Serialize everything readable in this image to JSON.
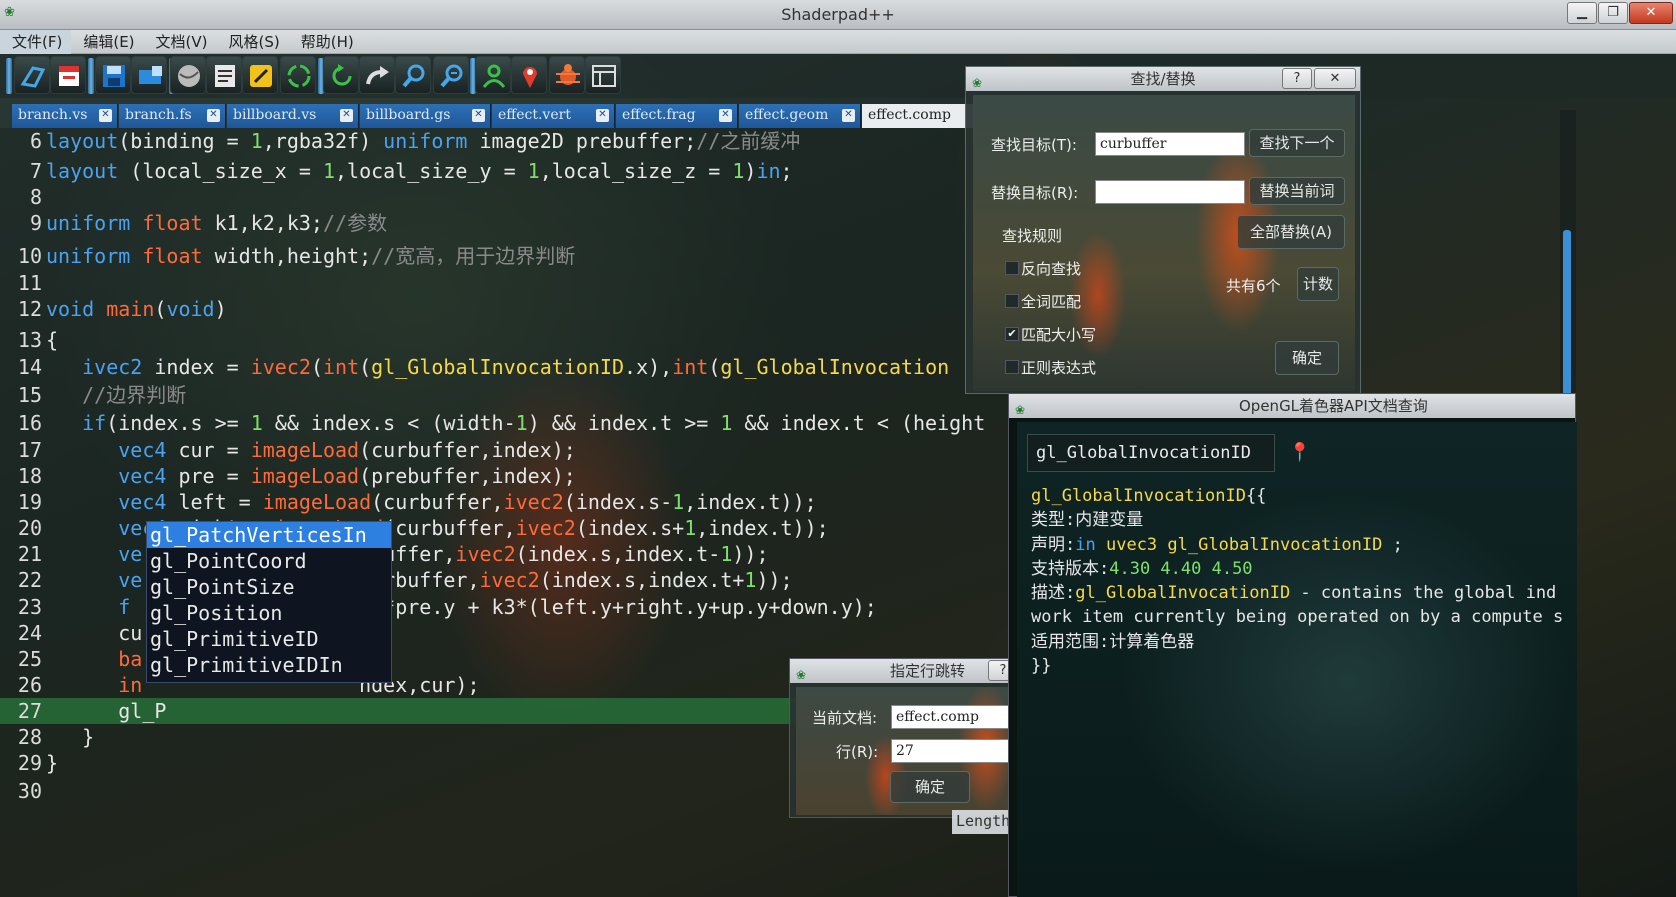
{
  "window": {
    "title": "Shaderpad++",
    "min": "▁",
    "max": "❐",
    "close": "✕"
  },
  "menu": [
    "文件(F)",
    "编辑(E)",
    "文档(V)",
    "风格(S)",
    "帮助(H)"
  ],
  "toolbar_icons": [
    "open-icon",
    "close-doc-icon",
    "save-icon",
    "save-as-icon",
    "sphere-icon",
    "document-icon",
    "edit-icon",
    "refresh-icon",
    "undo-icon",
    "redo-icon",
    "find-icon",
    "replace-icon",
    "user-icon",
    "location-icon",
    "bug-icon",
    "panel-icon"
  ],
  "tabs": [
    {
      "label": "branch.vs"
    },
    {
      "label": "branch.fs"
    },
    {
      "label": "billboard.vs"
    },
    {
      "label": "billboard.gs"
    },
    {
      "label": "effect.vert"
    },
    {
      "label": "effect.frag"
    },
    {
      "label": "effect.geom"
    },
    {
      "label": "effect.comp"
    }
  ],
  "editor": {
    "current_line": 27,
    "lines": [
      {
        "n": "6",
        "html": "<span class='kw'>layout</span>(binding = <span class='num'>1</span>,rgba32f) <span class='kw'>uniform</span> image2D prebuffer;<span class='cm'>//之前缓冲</span>"
      },
      {
        "n": "7",
        "html": "<span class='kw'>layout</span> (local_size_x = <span class='num'>1</span>,local_size_y = <span class='num'>1</span>,local_size_z = <span class='num'>1</span>)<span class='kw'>in</span>;"
      },
      {
        "n": "8",
        "html": ""
      },
      {
        "n": "9",
        "html": "<span class='kw'>uniform</span> <span class='fn'>float</span> k1,k2,k3;<span class='cm'>//参数</span>"
      },
      {
        "n": "10",
        "html": "<span class='kw'>uniform</span> <span class='fn'>float</span> width,height;<span class='cm'>//宽高，用于边界判断</span>"
      },
      {
        "n": "11",
        "html": ""
      },
      {
        "n": "12",
        "html": "<span class='kw'>void</span> <span class='fn'>main</span>(<span class='kw'>void</span>)"
      },
      {
        "n": "13",
        "html": "{"
      },
      {
        "n": "14",
        "html": "   <span class='kw'>ivec2</span> index = <span class='fn'>ivec2</span>(<span class='fn'>int</span>(<span class='gv'>gl_GlobalInvocationID</span>.x),<span class='fn'>int</span>(<span class='gv'>gl_GlobalInvocation</span>"
      },
      {
        "n": "15",
        "html": "   <span class='cm'>//边界判断</span>"
      },
      {
        "n": "16",
        "html": "   <span class='kw'>if</span>(index.s &gt;= <span class='num'>1</span> &amp;&amp; index.s &lt; (width-<span class='num'>1</span>) &amp;&amp; index.t &gt;= <span class='num'>1</span> &amp;&amp; index.t &lt; (height"
      },
      {
        "n": "17",
        "html": "      <span class='kw'>vec4</span> cur = <span class='fn'>imageLoad</span>(curbuffer,index);"
      },
      {
        "n": "18",
        "html": "      <span class='kw'>vec4</span> pre = <span class='fn'>imageLoad</span>(prebuffer,index);"
      },
      {
        "n": "19",
        "html": "      <span class='kw'>vec4</span> left = <span class='fn'>imageLoad</span>(curbuffer,<span class='fn'>ivec2</span>(index.s-<span class='num'>1</span>,index.t));"
      },
      {
        "n": "20",
        "html": "      <span class='kw'>vec4</span> right = <span class='fn'>imageLoad</span>(curbuffer,<span class='fn'>ivec2</span>(index.s+<span class='num'>1</span>,index.t));"
      },
      {
        "n": "21",
        "html": "      <span class='kw'>ve</span>                  rbuffer,<span class='fn'>ivec2</span>(index.s,index.t-<span class='num'>1</span>));"
      },
      {
        "n": "22",
        "html": "      <span class='kw'>ve</span>                  curbuffer,<span class='fn'>ivec2</span>(index.s,index.t+<span class='num'>1</span>));"
      },
      {
        "n": "23",
        "html": "      <span class='kw'>f</span>                   k2*pre.y + k3*(left.y+right.y+up.y+down.y);"
      },
      {
        "n": "24",
        "html": "      cu"
      },
      {
        "n": "25",
        "html": "      <span class='fn'>ba</span>"
      },
      {
        "n": "26",
        "html": "      <span class='fn'>in</span>                  ndex,cur);"
      },
      {
        "n": "27",
        "html": "      gl_P"
      },
      {
        "n": "28",
        "html": "   }"
      },
      {
        "n": "29",
        "html": "}"
      },
      {
        "n": "30",
        "html": ""
      }
    ]
  },
  "autocomplete": [
    "gl_PatchVerticesIn",
    "gl_PointCoord",
    "gl_PointSize",
    "gl_Position",
    "gl_PrimitiveID",
    "gl_PrimitiveIDIn"
  ],
  "find_dialog": {
    "title": "查找/替换",
    "help_label": "?",
    "close_label": "✕",
    "find_label": "查找目标(T):",
    "find_value": "curbuffer",
    "find_next": "查找下一个",
    "replace_label": "替换目标(R):",
    "replace_value": "",
    "replace_current": "替换当前词",
    "replace_all": "全部替换(A)",
    "rules_label": "查找规则",
    "options": [
      {
        "label": "反向查找",
        "checked": false
      },
      {
        "label": "全词匹配",
        "checked": false
      },
      {
        "label": "匹配大小写",
        "checked": true
      },
      {
        "label": "正则表达式",
        "checked": false
      }
    ],
    "count_text": "共有6个",
    "count_button": "计数",
    "ok_button": "确定"
  },
  "api_dialog": {
    "title": "OpenGL着色器API文档查询",
    "search_value": "gl_GlobalInvocationID",
    "lines": [
      {
        "html": "<span class='tyel'>gl_GlobalInvocationID</span>{{"
      },
      {
        "html": "类型:内建变量"
      },
      {
        "html": "声明:<span class='tblu'>in</span> <span class='tyel'>uvec3</span> <span class='tyel'>gl_GlobalInvocationID</span> ;"
      },
      {
        "html": "支持版本:<span class='tgrn'>4.30 4.40 4.50</span>"
      },
      {
        "html": "描述:<span class='tyel'>gl_GlobalInvocationID</span> - contains the global ind"
      },
      {
        "html": "work item currently being operated on by a compute s"
      },
      {
        "html": "适用范围:计算着色器"
      },
      {
        "html": "}}"
      }
    ]
  },
  "goto_dialog": {
    "title": "指定行跳转",
    "doc_label": "当前文档:",
    "doc_value": "effect.comp",
    "line_label": "行(R):",
    "line_value": "27",
    "ok_button": "确定"
  },
  "length_tag": "Length"
}
